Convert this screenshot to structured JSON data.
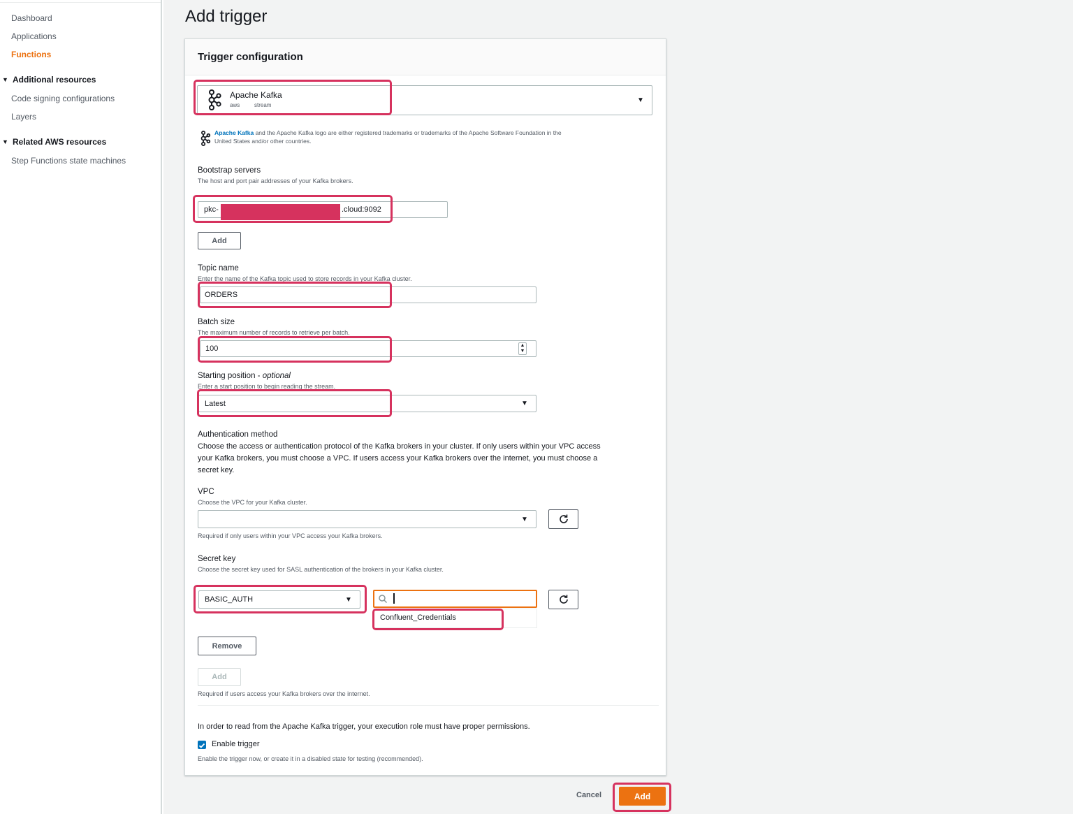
{
  "sidebar": {
    "items": [
      {
        "label": "Dashboard"
      },
      {
        "label": "Applications"
      },
      {
        "label": "Functions"
      }
    ],
    "sections": [
      {
        "label": "Additional resources",
        "items": [
          "Code signing configurations",
          "Layers"
        ]
      },
      {
        "label": "Related AWS resources",
        "items": [
          "Step Functions state machines"
        ]
      }
    ]
  },
  "page": {
    "title": "Add trigger",
    "panel_title": "Trigger configuration"
  },
  "source": {
    "name": "Apache Kafka",
    "tag1": "aws",
    "tag2": "stream",
    "notice_link": "Apache Kafka",
    "notice_line1": " and the Apache Kafka logo are either registered trademarks or trademarks of the Apache Software Foundation in the",
    "notice_line2": "United States and/or other countries."
  },
  "bootstrap": {
    "label": "Bootstrap servers",
    "desc": "The host and port pair addresses of your Kafka brokers.",
    "value_prefix": "pkc-",
    "value_suffix": ".cloud:9092",
    "add_label": "Add"
  },
  "topic": {
    "label": "Topic name",
    "desc": "Enter the name of the Kafka topic used to store records in your Kafka cluster.",
    "value": "ORDERS"
  },
  "batch": {
    "label": "Batch size",
    "desc": "The maximum number of records to retrieve per batch.",
    "value": "100"
  },
  "starting": {
    "label": "Starting position - ",
    "label_optional": "optional",
    "desc": "Enter a start position to begin reading the stream.",
    "value": "Latest"
  },
  "auth": {
    "label": "Authentication method",
    "line1": "Choose the access or authentication protocol of the Kafka brokers in your cluster. If only users within your VPC access",
    "line2": "your Kafka brokers, you must choose a VPC. If users access your Kafka brokers over the internet, you must choose a",
    "line3": "secret key."
  },
  "vpc": {
    "label": "VPC",
    "desc": "Choose the VPC for your Kafka cluster.",
    "value": "",
    "help": "Required if only users within your VPC access your Kafka brokers."
  },
  "secret": {
    "label": "Secret key",
    "desc": "Choose the secret key used for SASL authentication of the brokers in your Kafka cluster.",
    "type_value": "BASIC_AUTH",
    "search_value": "",
    "option": "Confluent_Credentials",
    "remove_label": "Remove",
    "add_label": "Add",
    "help": "Required if users access your Kafka brokers over the internet."
  },
  "permissions": {
    "note": "In order to read from the Apache Kafka trigger, your execution role must have proper permissions.",
    "enable_label": "Enable trigger",
    "enable_checked": true,
    "enable_desc": "Enable the trigger now, or create it in a disabled state for testing (recommended)."
  },
  "footer": {
    "cancel_label": "Cancel",
    "add_label": "Add"
  },
  "colors": {
    "accent": "#ec7211",
    "highlight": "#d6325e",
    "link": "#0073bb",
    "checkbox": "#0073bb"
  },
  "icons": {
    "kafka": "kafka-logo-icon",
    "dropdown": "caret-down-icon",
    "refresh": "refresh-icon",
    "search": "search-icon",
    "stepper": "stepper-icon",
    "checkbox": "checkbox-checked-icon"
  }
}
